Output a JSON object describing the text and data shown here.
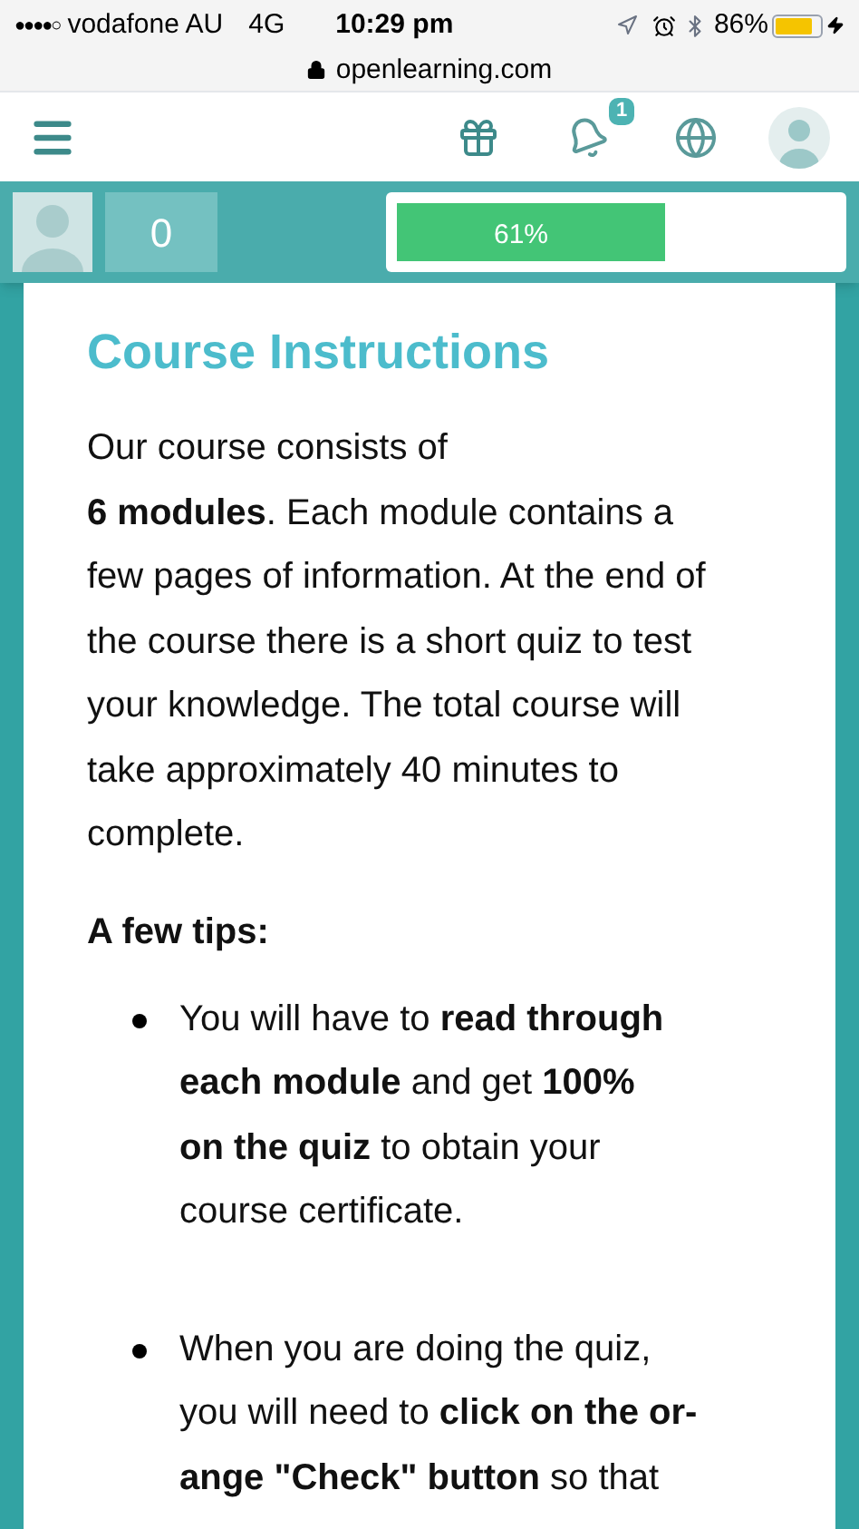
{
  "status_bar": {
    "signal": "●●●●○",
    "carrier": "vodafone AU",
    "network": "4G",
    "time": "10:29 pm",
    "battery": "86%",
    "url": "openlearning.com"
  },
  "nav": {
    "notification_count": "1"
  },
  "progress_header": {
    "score": "0",
    "progress": {
      "level": 0.61,
      "label": "61%"
    }
  },
  "content": {
    "title": "Course Instructions",
    "paragraph": "Our course consists of\n**6 modules**. Each module contains a few pages of information. At the end of the course there is a short quiz to test your knowledge. The total course will take approximately 40 minutes to complete.",
    "tips_heading": "A few tips:",
    "tips": [
      "You will have to **read through each module** and get **100%**\n**on the quiz** to obtain your course certificate.",
      "When you are doing the quiz, you will need to **click on the or-ange \"Check\" button** so that"
    ]
  }
}
